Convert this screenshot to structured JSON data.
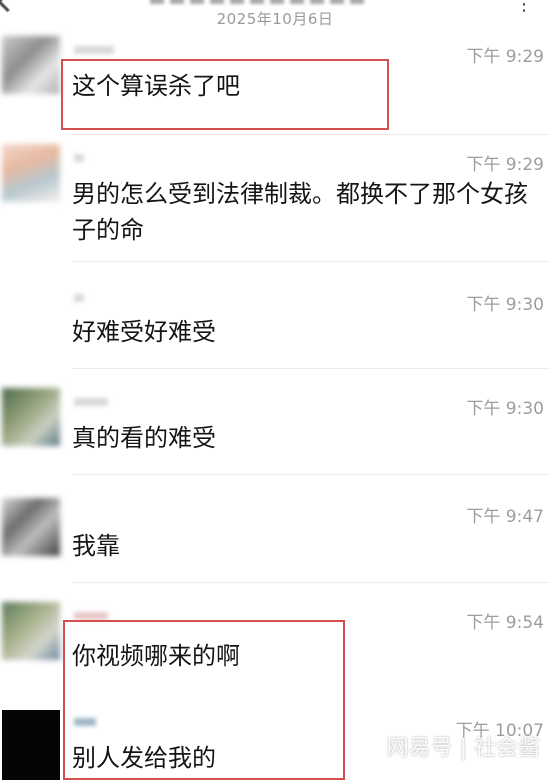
{
  "header": {
    "date": "2025年10月6日"
  },
  "messages": [
    {
      "time": "下午 9:29",
      "text": "这个算误杀了吧"
    },
    {
      "time": "下午 9:29",
      "text": "男的怎么受到法律制裁。都换不了那个女孩子的命"
    },
    {
      "time": "下午 9:30",
      "text": "好难受好难受"
    },
    {
      "time": "下午 9:30",
      "text": "真的看的难受"
    },
    {
      "time": "下午 9:47",
      "text": "我靠"
    },
    {
      "time": "下午 9:54",
      "text": "你视频哪来的啊"
    },
    {
      "time": "下午 10:07",
      "text": "别人发给我的"
    }
  ],
  "colors": {
    "highlight": "#d2504f",
    "time": "#9d9d9d",
    "text": "#151515"
  },
  "watermark": "网易号 | 社会酱"
}
